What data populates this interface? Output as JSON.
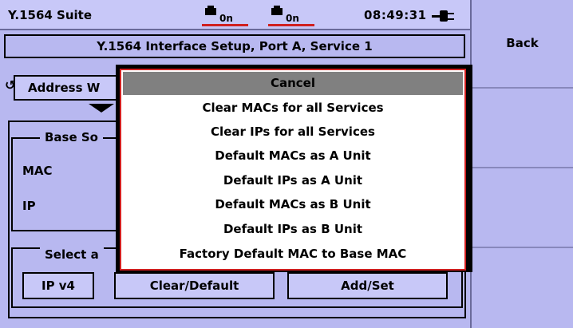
{
  "status": {
    "app_title": "Y.1564 Suite",
    "port_a_text": "0n",
    "port_b_text": "0n",
    "clock": "08:49:31"
  },
  "header": {
    "title": "Y.1564 Interface Setup, Port A, Service 1"
  },
  "address_wizard_label": "Address W",
  "base_group": {
    "label": "Base So",
    "mac_label": "MAC",
    "ip_label": "IP"
  },
  "select_group": {
    "label": "Select a"
  },
  "buttons": {
    "ipv4": "IP v4",
    "clear_default": "Clear/Default",
    "add_set": "Add/Set"
  },
  "softkeys": {
    "back": "Back"
  },
  "menu": {
    "items": [
      "Cancel",
      "Clear MACs for all Services",
      "Clear IPs for all Services",
      "Default MACs as A Unit",
      "Default IPs as A Unit",
      "Default MACs as B Unit",
      "Default IPs as B Unit",
      "Factory Default MAC to Base MAC"
    ],
    "selected_index": 0
  },
  "colors": {
    "background": "#b8b8f0",
    "selection": "#808080",
    "menu_border": "#d02020"
  }
}
